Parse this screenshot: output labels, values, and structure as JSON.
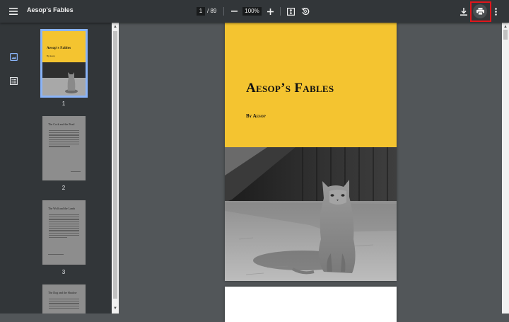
{
  "toolbar": {
    "title": "Aesop's Fables",
    "current_page": "1",
    "page_total": "/ 89",
    "zoom": "100%",
    "icons": [
      "menu-icon",
      "zoom-out-icon",
      "zoom-in-icon",
      "fit-page-icon",
      "rotate-icon",
      "download-icon",
      "print-icon",
      "more-vert-icon"
    ]
  },
  "sidebar": {
    "icons": [
      "thumbnails-icon",
      "outline-icon"
    ],
    "thumbnails": [
      {
        "number": "1",
        "title": "Aesop's Fables",
        "byline": "By Aesop"
      },
      {
        "number": "2",
        "heading": "The Cock and the Pearl"
      },
      {
        "number": "3",
        "heading": "The Wolf and the Lamb"
      },
      {
        "heading": "The Dog and the Shadow"
      }
    ]
  },
  "document": {
    "cover_title": "Aesop’s Fables",
    "cover_byline": "By Aesop"
  },
  "colors": {
    "toolbar_bg": "#323639",
    "viewer_bg": "#525659",
    "cover_yellow": "#f4c430",
    "active_thumb": "#8ab4f8",
    "highlight_box": "#e0161b"
  }
}
